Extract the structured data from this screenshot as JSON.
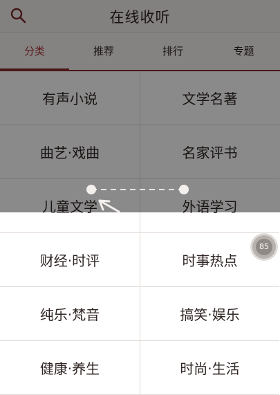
{
  "header": {
    "title": "在线收听"
  },
  "tabs": [
    {
      "label": "分类",
      "active": true
    },
    {
      "label": "推荐",
      "active": false
    },
    {
      "label": "排行",
      "active": false
    },
    {
      "label": "专题",
      "active": false
    }
  ],
  "categories": [
    "有声小说",
    "文学名著",
    "曲艺·戏曲",
    "名家评书",
    "儿童文学",
    "外语学习",
    "财经·时评",
    "时事热点",
    "纯乐·梵音",
    "搞笑·娱乐",
    "健康·养生",
    "时尚·生活"
  ],
  "float_badge": {
    "value": "85"
  },
  "colors": {
    "accent": "#8b2b2b",
    "active_tab_text": "#a83636"
  },
  "icons": {
    "search": "search-icon",
    "drag_hint": "drag-hint-icon"
  }
}
